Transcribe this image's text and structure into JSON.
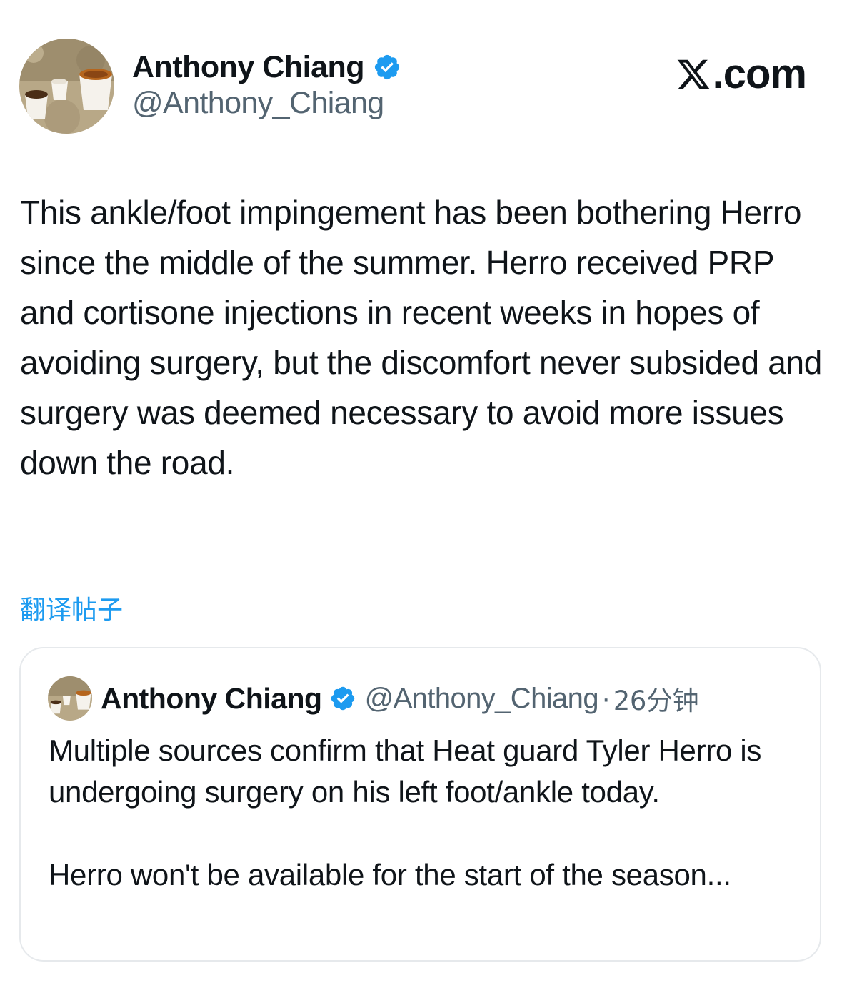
{
  "author": {
    "display_name": "Anthony Chiang",
    "handle": "@Anthony_Chiang",
    "verified_icon": "verified-badge-icon",
    "avatar_icon": "coffee-cups-photo"
  },
  "brand": {
    "logo_icon": "x-logo-icon",
    "suffix": ".com"
  },
  "tweet": {
    "text": "This ankle/foot impingement has been bothering Herro since the middle of the summer. Herro received PRP and cortisone injections in recent weeks in hopes of avoiding surgery, but the discomfort never subsided and surgery was deemed necessary to avoid more issues down the road."
  },
  "translate": {
    "label": "翻译帖子"
  },
  "quote": {
    "display_name": "Anthony Chiang",
    "handle": "@Anthony_Chiang",
    "separator": "·",
    "time": "26分钟",
    "paragraph_1": "Multiple sources confirm that Heat guard Tyler Herro is undergoing surgery on his left foot/ankle today.",
    "paragraph_2": "Herro won't be available for the start of the season..."
  },
  "colors": {
    "text": "#0f1419",
    "secondary": "#536471",
    "accent": "#1d9bf0",
    "border": "#e6e9ec"
  }
}
